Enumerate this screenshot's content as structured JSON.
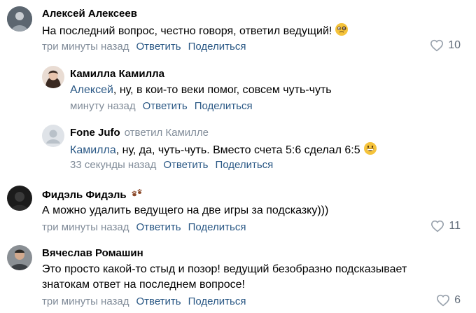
{
  "comments": [
    {
      "author": "Алексей Алексеев",
      "text": "На последний вопрос, честно говоря, ответил ведущий!",
      "emoji": "face-with-monocle-emoji",
      "time": "три минуты назад",
      "reply_label": "Ответить",
      "share_label": "Поделиться",
      "likes": "10"
    },
    {
      "author": "Камилла Камилла",
      "mention": "Алексей",
      "text": ", ну, в кои-то веки помог, совсем чуть-чуть",
      "time": "минуту назад",
      "reply_label": "Ответить",
      "share_label": "Поделиться"
    },
    {
      "author": "Fone Jufo",
      "replied_to": "ответил Камилле",
      "mention": "Камилла",
      "text": ", ну, да, чуть-чуть. Вместо счета 5:6 сделал 6:5",
      "emoji": "grinning-face-emoji",
      "time": "33 секунды назад",
      "reply_label": "Ответить",
      "share_label": "Поделиться"
    },
    {
      "author": "Фидэль Фидэль",
      "badge": "paw-prints-icon",
      "text": "А можно удалить ведущего на две игры за подсказку)))",
      "time": "три минуты назад",
      "reply_label": "Ответить",
      "share_label": "Поделиться",
      "likes": "11"
    },
    {
      "author": "Вячеслав Ромашин",
      "text_line1": "Это просто какой-то стыд и позор! ведущий безобразно подсказывает",
      "text_line2": "знатокам ответ на последнем вопросе!",
      "time": "три минуты назад",
      "reply_label": "Ответить",
      "share_label": "Поделиться",
      "likes": "6"
    }
  ],
  "colors": {
    "link": "#2a5885",
    "meta": "#818c99",
    "like_icon": "#99a2ad"
  }
}
